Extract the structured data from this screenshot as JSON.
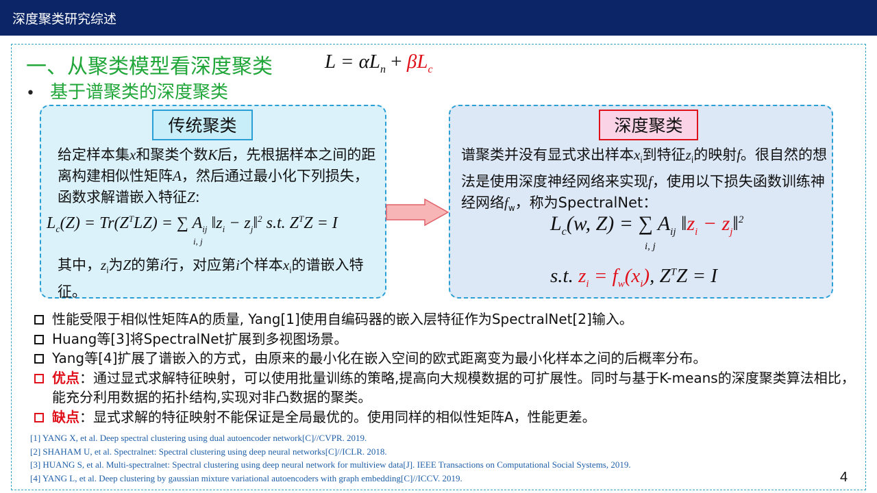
{
  "header": {
    "title": "深度聚类研究综述"
  },
  "section": {
    "title": "一、从聚类模型看深度聚类",
    "formula_black": "L = αL",
    "formula_black_sub": "n",
    "formula_plus": " + ",
    "formula_red": "βL",
    "formula_red_sub": "c",
    "subtitle": "基于谱聚类的深度聚类",
    "bullet_dot": "•"
  },
  "left_box": {
    "tag": "传统聚类",
    "paragraph_parts": [
      "给定样本集",
      "x",
      "和聚类个数",
      "K",
      "后，先根据样本之间的距离构建相似性矩阵",
      "A",
      "，然后通过最小化下列损失，函数求解谱嵌入特征",
      "Z",
      ":"
    ],
    "formula": "L_c(Z) = Tr(Z^T LZ) = Σ_{i,j} A_ij ||z_i − z_j||² s.t. Z^T Z = I",
    "formula_parts": {
      "lhs": "L",
      "c": "c",
      "rest1": "(Z) = Tr(Z",
      "T": "T",
      "rest2": "LZ) = ∑ A",
      "ij": "ij",
      "rest3": " ‖z",
      "i": "i",
      "minus": " − z",
      "j": "j",
      "rest4": "‖",
      "two": "2",
      "st": "   s.t. Z",
      "T2": "T",
      "rest5": "Z = I",
      "under": "i, j"
    },
    "note_parts": [
      "其中，",
      "z",
      "i",
      "为",
      "Z",
      "的第",
      "i",
      "行，对应第",
      "i",
      "个样本",
      "x",
      "i",
      "的谱嵌入特征。"
    ]
  },
  "right_box": {
    "tag": "深度聚类",
    "paragraph_parts": [
      "谱聚类并没有显式求出样本",
      "x",
      "i",
      "到特征",
      "z",
      "i",
      "的映射",
      "f",
      "。很自然的想法是使用深度神经网络来实现",
      "f",
      "，使用以下损失函数训练神经网络",
      "f",
      "w",
      "，称为SpectralNet："
    ],
    "formula1": "L_c(w,Z) = Σ_{i,j} A_ij ||z_i − z_j||²",
    "formula1_parts": {
      "lhs": "L",
      "c": "c",
      "rest1": "(w, Z) = ∑ A",
      "ij": "ij",
      "bar": " ‖",
      "zi": "z",
      "i": "i",
      "minus": " − ",
      "zj": "z",
      "j": "j",
      "bar2": "‖",
      "two": "2",
      "under": "i, j"
    },
    "formula2": "s.t. z_i = f_w(x_i), Z^T Z = I",
    "formula2_parts": {
      "st": "s.t. ",
      "zi": "z",
      "i": "i",
      "eq": " = f",
      "w": "w",
      "xi": "(x",
      "i2": "i",
      "close": ")",
      "rest": ", Z",
      "T": "T",
      "end": "Z = I"
    }
  },
  "bullets": [
    {
      "text": "性能受限于相似性矩阵A的质量, Yang[1]使用自编码器的嵌入层特征作为SpectralNet[2]输入。",
      "emph": "",
      "color": "#111111"
    },
    {
      "text": "Huang等[3]将SpectralNet扩展到多视图场景。",
      "emph": "",
      "color": "#111111"
    },
    {
      "text": "Yang等[4]扩展了谱嵌入的方式，由原来的最小化在嵌入空间的欧式距离变为最小化样本之间的后概率分布。",
      "emph": "",
      "color": "#111111"
    },
    {
      "emph": "优点",
      "text": "：通过显式求解特征映射，可以使用批量训练的策略,提高向大规模数据的可扩展性。同时与基于K-means的深度聚类算法相比，能充分利用数据的拓扑结构,实现对非凸数据的聚类。",
      "color": "#e0101a"
    },
    {
      "emph": "缺点",
      "text": "：显式求解的特征映射不能保证是全局最优的。使用同样的相似性矩阵A，性能更差。",
      "color": "#e0101a"
    }
  ],
  "references": [
    "[1] YANG X, et al. Deep spectral clustering  using  dual autoencoder network[C]//CVPR.  2019.",
    "[2] SHAHAM U, et al. Spectralnet:  Spectral  clustering  using  deep neural  networks[C]//ICLR.  2018.",
    "[3] HUANG S, et al. Multi-spectralnet:  Spectral  clustering  using  deep neural  network for multiview  data[J]. IEEE Transactions  on Computational  Social  Systems,  2019.",
    "[4] YANG L, et al. Deep clustering  by gaussian  mixture  variational  autoencoders  with  graph embedding[C]//ICCV.  2019."
  ],
  "page_number": "4",
  "colors": {
    "header": "#0b2566",
    "green": "#21a63a",
    "red": "#e0101a",
    "blue_border": "#2a9fd6",
    "ref_blue": "#1f5fa8"
  }
}
